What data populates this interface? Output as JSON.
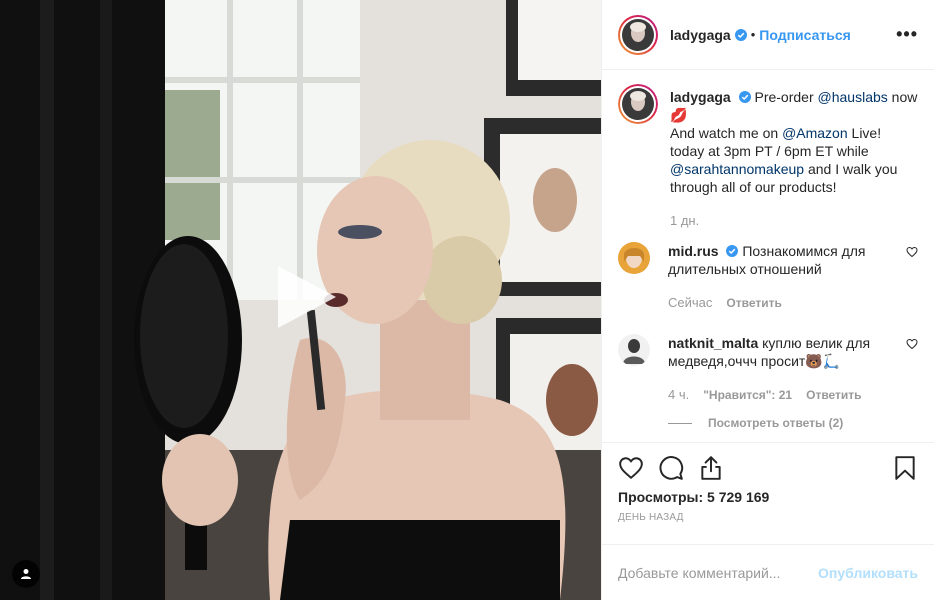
{
  "post": {
    "username": "ladygaga",
    "follow_label": "Подписаться",
    "dot": "•",
    "more_label": "•••"
  },
  "caption": {
    "username": "ladygaga",
    "text_1": "Pre-order ",
    "mention_1": "@hauslabs",
    "text_2": " now ",
    "emoji_1": "💋",
    "text_3": "And watch me on ",
    "mention_2": "@Amazon",
    "text_4": " Live! today at 3pm PT / 6pm ET while ",
    "mention_3": "@sarahtannomakeup",
    "text_5": " and I walk you through all of our products!",
    "time": "1 дн."
  },
  "comments": [
    {
      "username": "mid.rus",
      "text": "Познакомимся для длительных отношений",
      "time": "Сейчас",
      "reply_label": "Ответить"
    },
    {
      "username": "natknit_malta",
      "text": "куплю велик для медведя,оччч просит",
      "emoji": "🐻🛴",
      "time": "4 ч.",
      "likes_label": "\"Нравится\": 21",
      "reply_label": "Ответить",
      "view_replies": "Посмотреть ответы (2)"
    }
  ],
  "stats": {
    "views_label": "Просмотры: 5 729 169",
    "date": "День назад"
  },
  "composer": {
    "placeholder": "Добавьте комментарий...",
    "publish_label": "Опубликовать"
  },
  "icons": {
    "verified": "verified-badge-icon",
    "play": "play-icon",
    "tag": "user-tag-icon",
    "like": "heart-icon",
    "comment": "comment-icon",
    "share": "share-icon",
    "save": "bookmark-icon"
  },
  "colors": {
    "link": "#003569",
    "follow": "#3897f0",
    "publish_disabled": "#b2dffc",
    "muted": "#999999"
  }
}
